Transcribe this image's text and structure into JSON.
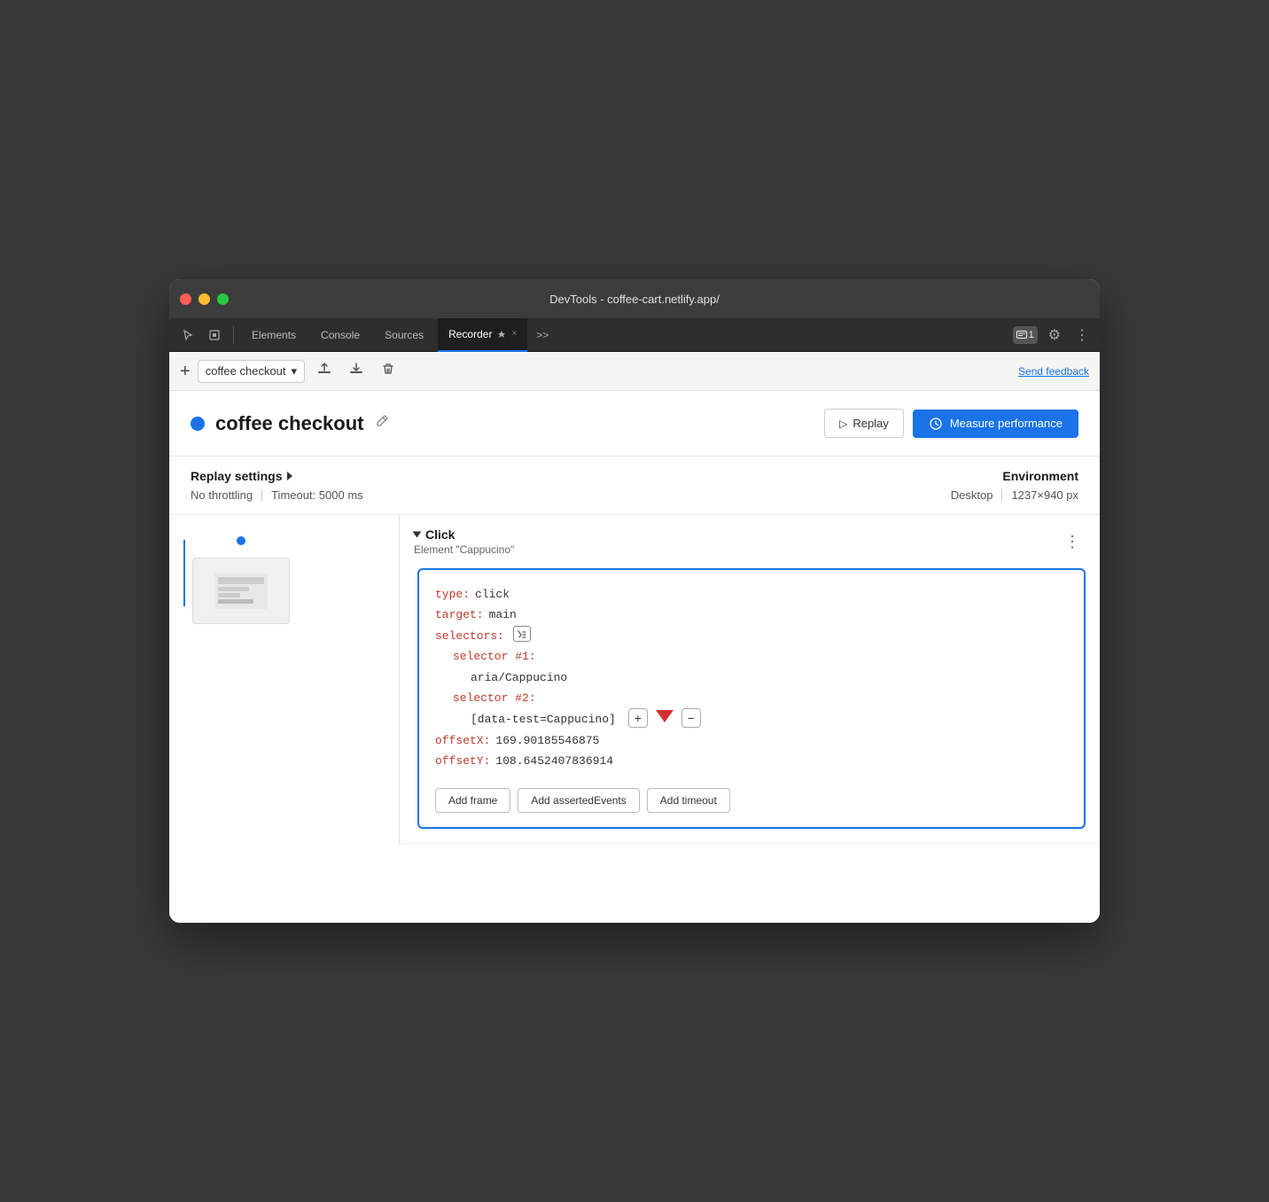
{
  "window": {
    "title": "DevTools - coffee-cart.netlify.app/"
  },
  "tabs": [
    {
      "label": "Elements",
      "active": false
    },
    {
      "label": "Console",
      "active": false
    },
    {
      "label": "Sources",
      "active": false
    },
    {
      "label": "Recorder",
      "active": true
    },
    {
      "label": "×",
      "active": false
    }
  ],
  "toolbar": {
    "add_label": "+",
    "recording_name": "coffee checkout",
    "send_feedback": "Send feedback"
  },
  "recording": {
    "title": "coffee checkout",
    "replay_label": "Replay",
    "measure_label": "Measure performance"
  },
  "settings": {
    "header": "Replay settings",
    "throttling": "No throttling",
    "timeout": "Timeout: 5000 ms",
    "env_label": "Environment",
    "env_type": "Desktop",
    "env_size": "1237×940 px"
  },
  "step": {
    "type": "Click",
    "subtitle": "Element \"Cappucino\"",
    "code": {
      "type_key": "type:",
      "type_value": "click",
      "target_key": "target:",
      "target_value": "main",
      "selectors_key": "selectors:",
      "selector1_key": "selector #1:",
      "selector1_value": "aria/Cappucino",
      "selector2_key": "selector #2:",
      "selector2_value": "[data-test=Cappucino]",
      "offsetX_key": "offsetX:",
      "offsetX_value": "169.90185546875",
      "offsetY_key": "offsetY:",
      "offsetY_value": "108.6452407836914"
    },
    "actions": {
      "add_frame": "Add frame",
      "add_asserted": "Add assertedEvents",
      "add_timeout": "Add timeout"
    }
  },
  "icons": {
    "chat_badge": "1",
    "settings": "⚙",
    "more": "⋮",
    "play": "▷",
    "edit": "✏",
    "export": "↑",
    "import": "↓",
    "delete": "🗑",
    "chevron_down": "▾",
    "chevron_right": "▶",
    "selector_icon": "⌥"
  }
}
